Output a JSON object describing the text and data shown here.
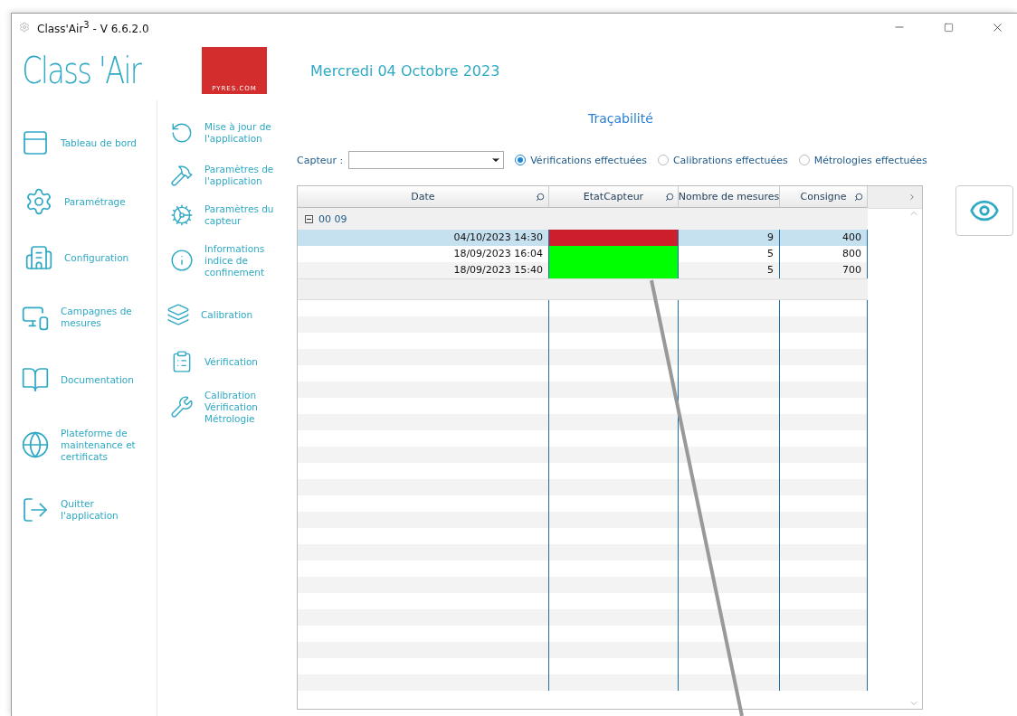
{
  "window": {
    "title": "Class'Air$^{3}$ - V 6.6.2.0"
  },
  "header": {
    "app_name": "Class 'Air",
    "logo_text": "PYRES.COM",
    "date": "Mercredi 04 Octobre 2023"
  },
  "nav_main": [
    {
      "label": "Tableau de bord",
      "kind": "dashboard"
    },
    {
      "label": "Paramétrage",
      "kind": "settings"
    },
    {
      "label": "Configuration",
      "kind": "building"
    },
    {
      "label": "Campagnes de mesures",
      "kind": "monitor"
    },
    {
      "label": "Documentation",
      "kind": "book"
    },
    {
      "label": "Plateforme de maintenance et certificats",
      "kind": "globe"
    },
    {
      "label": "Quitter l'application",
      "kind": "exit"
    }
  ],
  "nav_secondary": [
    {
      "label": "Mise à jour de l'application",
      "kind": "refresh"
    },
    {
      "label": "Paramètres de l'application",
      "kind": "hammer"
    },
    {
      "label": "Paramètres du capteur",
      "kind": "cogs"
    },
    {
      "label": "Informations indice de confinement",
      "kind": "info"
    },
    {
      "label": "Calibration",
      "kind": "layers"
    },
    {
      "label": "Vérification",
      "kind": "clipboard"
    },
    {
      "label": "Calibration Vérification Métrologie",
      "kind": "tools"
    }
  ],
  "panel": {
    "title": "Traçabilité",
    "sensor_label": "Capteur :",
    "modes": [
      {
        "label": "Vérifications effectuées",
        "selected": true
      },
      {
        "label": "Calibrations effectuées",
        "selected": false
      },
      {
        "label": "Métrologies effectuées",
        "selected": false
      }
    ]
  },
  "table": {
    "columns": [
      "Date",
      "EtatCapteur",
      "Nombre de mesures",
      "Consigne"
    ],
    "group": {
      "label": "00 09",
      "expanded": true
    },
    "rows": [
      {
        "date": "04/10/2023 14:30",
        "color": "#cc1f2b",
        "measures": "9",
        "setpoint": "400",
        "selected": true
      },
      {
        "date": "18/09/2023 16:04",
        "color": "#00ff00",
        "measures": "5",
        "setpoint": "800",
        "selected": false
      },
      {
        "date": "18/09/2023 15:40",
        "color": "#00ff00",
        "measures": "5",
        "setpoint": "700",
        "selected": false
      }
    ]
  }
}
